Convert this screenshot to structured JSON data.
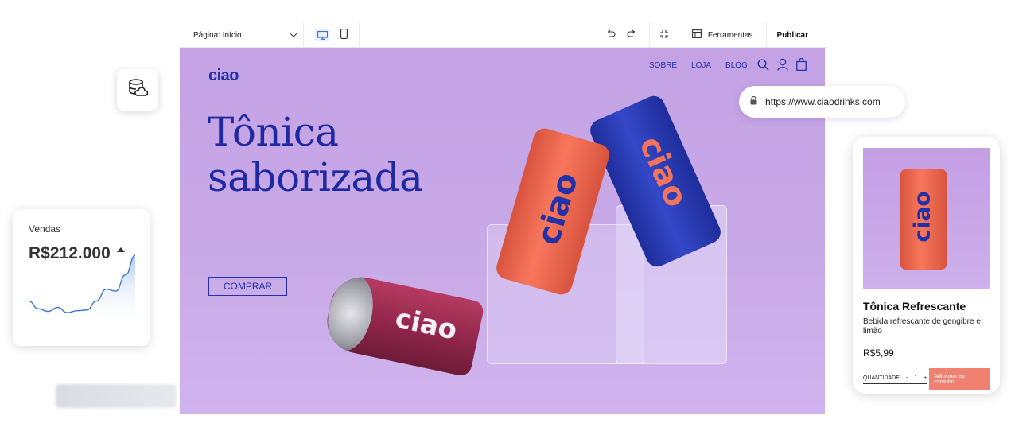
{
  "editor": {
    "page_select": "Página: Início",
    "tools_label": "Ferramentas",
    "publish_label": "Publicar"
  },
  "site": {
    "logo": "ciao",
    "nav": [
      "SOBRE",
      "LOJA",
      "BLOG"
    ],
    "headline_line1": "Tônica",
    "headline_line2": "saborizada",
    "buy_button": "COMPRAR",
    "can_brand": "ciao"
  },
  "url_bar": {
    "url": "https://www.ciaodrinks.com"
  },
  "sales_card": {
    "label": "Vendas",
    "value": "R$212.000",
    "trend": [
      0.7,
      0.82,
      0.86,
      0.8,
      0.88,
      0.85,
      0.84,
      0.7,
      0.52,
      0.55,
      0.3,
      0.0
    ]
  },
  "product_card": {
    "title": "Tônica Refrescante",
    "description": "Bebida refrescante de gengibre e limão",
    "price": "R$5,99",
    "quantity_label": "QUANTIDADE",
    "quantity_minus": "-",
    "quantity_value": "1",
    "quantity_plus": "+",
    "add_to_cart": "Adicionar ao carrinho"
  },
  "colors": {
    "brand_blue": "#2231a8",
    "site_bg": "#c6a5e6",
    "can_red": "#9c2a4e",
    "can_orange": "#f2684f",
    "can_blue": "#2a3bb8",
    "cart_button": "#f08070",
    "chart_line": "#3a78d8"
  },
  "icons": [
    "stack-icon",
    "desktop-icon",
    "mobile-icon",
    "undo-icon",
    "redo-icon",
    "zoom-out-icon",
    "tools-icon",
    "search-icon",
    "user-icon",
    "cart-icon",
    "lock-icon",
    "database-icon"
  ]
}
